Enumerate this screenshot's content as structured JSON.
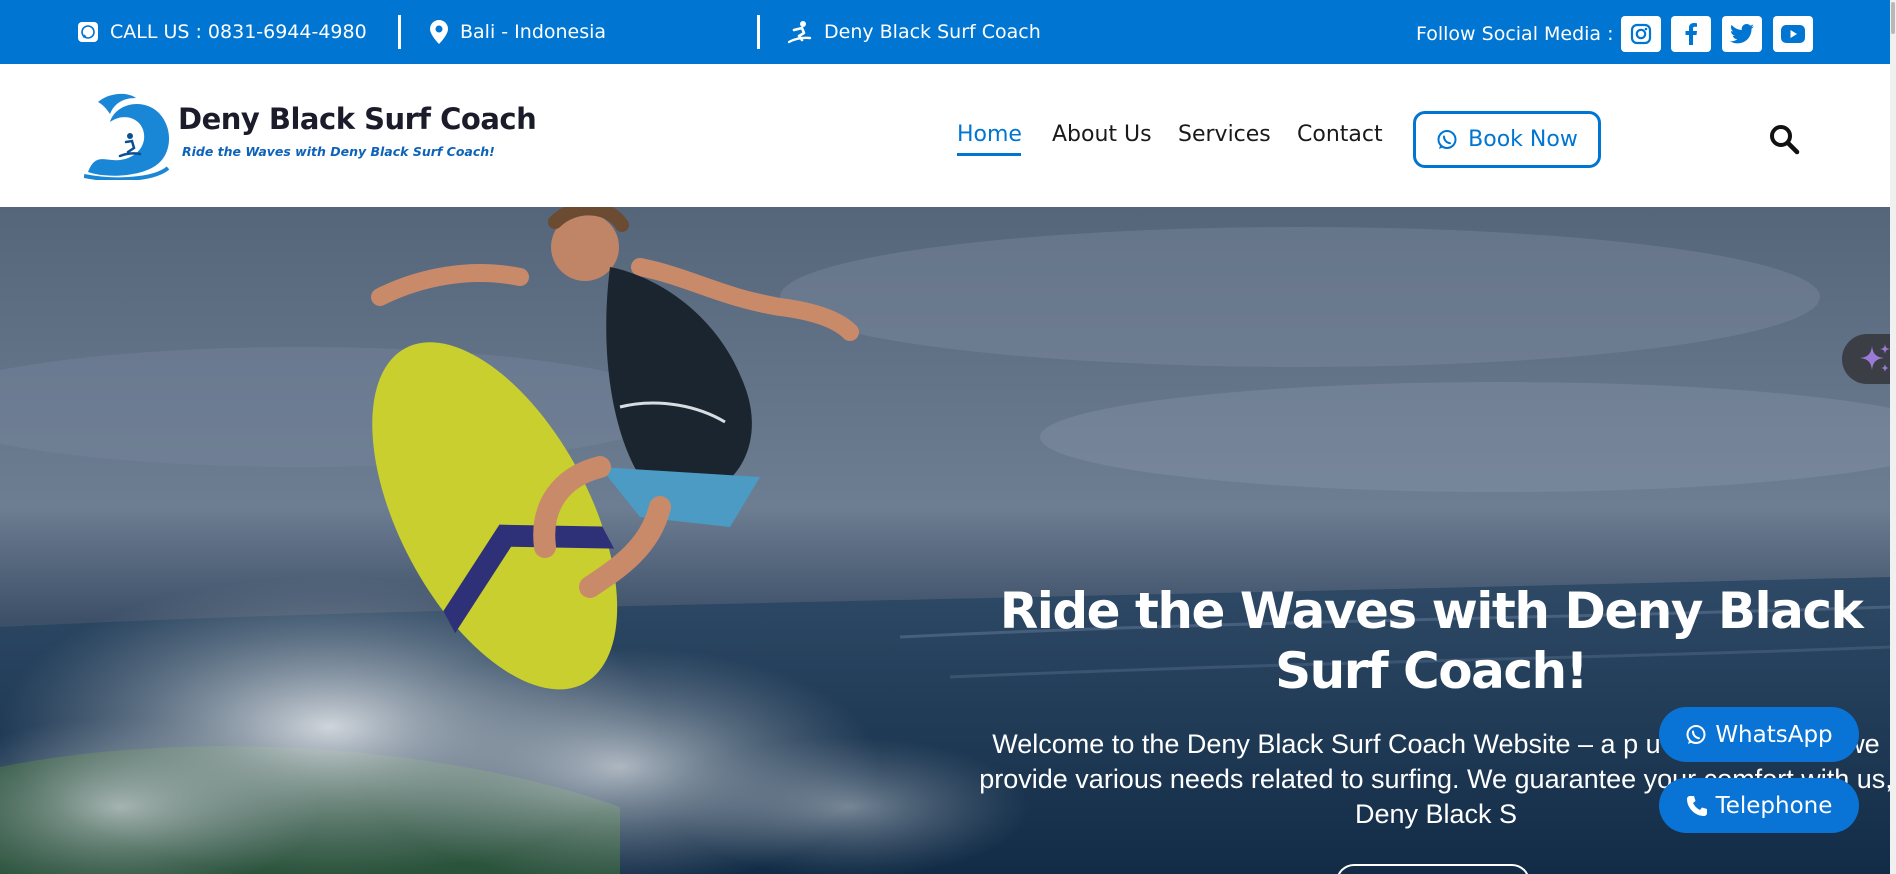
{
  "topbar": {
    "phone": "CALL US : 0831-6944-4980",
    "location": "Bali - Indonesia",
    "brand": "Deny Black Surf Coach",
    "social_label": "Follow Social Media :",
    "social": [
      "instagram-icon",
      "facebook-icon",
      "twitter-icon",
      "youtube-icon"
    ],
    "background": "#0075d1"
  },
  "header": {
    "logo_title": "Deny Black Surf Coach",
    "logo_tagline": "Ride the Waves with Deny Black Surf Coach!",
    "nav": [
      "Home",
      "About Us",
      "Services",
      "Contact"
    ],
    "active_nav": "Home",
    "book_label": "Book Now",
    "accent": "#0075d1"
  },
  "hero": {
    "title": "Ride the Waves with Deny Black Surf Coach!",
    "text": "Welcome to the Deny Black Surf Coach Website –  a p                               u can surf. Here we provide various needs related to surfing. We guarantee your comfort with us, Deny Black S"
  },
  "floating": {
    "whatsapp_label": "WhatsApp",
    "telephone_label": "Telephone",
    "button_color": "#0a74d6"
  }
}
